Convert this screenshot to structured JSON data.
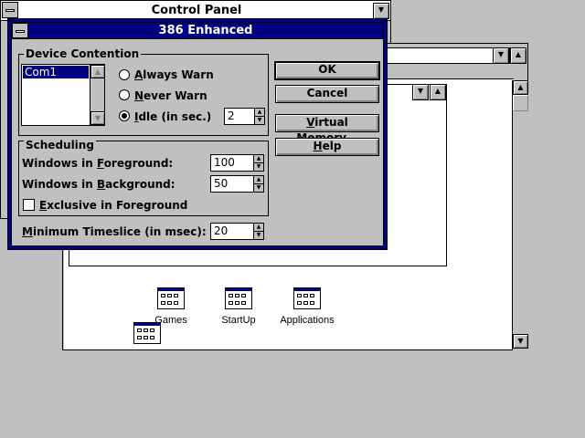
{
  "control_panel": {
    "title": "Control Panel"
  },
  "dialog": {
    "title": "386 Enhanced",
    "device_contention": {
      "label": "Device Contention",
      "devices": [
        "Com1"
      ],
      "selected_device": "Com1",
      "options": [
        "Always Warn",
        "Never Warn",
        "Idle (in sec.)"
      ],
      "selected_option": "Idle (in sec.)",
      "idle_seconds": "2"
    },
    "scheduling": {
      "label": "Scheduling",
      "foreground_label": "Windows in Foreground:",
      "foreground_value": "100",
      "background_label": "Windows in Background:",
      "background_value": "50",
      "exclusive_label": "Exclusive in Foreground",
      "exclusive_checked": false
    },
    "timeslice_label": "Minimum Timeslice (in msec):",
    "timeslice_value": "20",
    "buttons": {
      "ok": "OK",
      "cancel": "Cancel",
      "virtual_memory": "Virtual Memory...",
      "help": "Help"
    }
  },
  "program_manager": {
    "groups": [
      "Games",
      "StartUp",
      "Applications"
    ]
  },
  "colors": {
    "desktop": "#c0c0c0",
    "active_title": "#000080",
    "window": "#ffffff"
  }
}
